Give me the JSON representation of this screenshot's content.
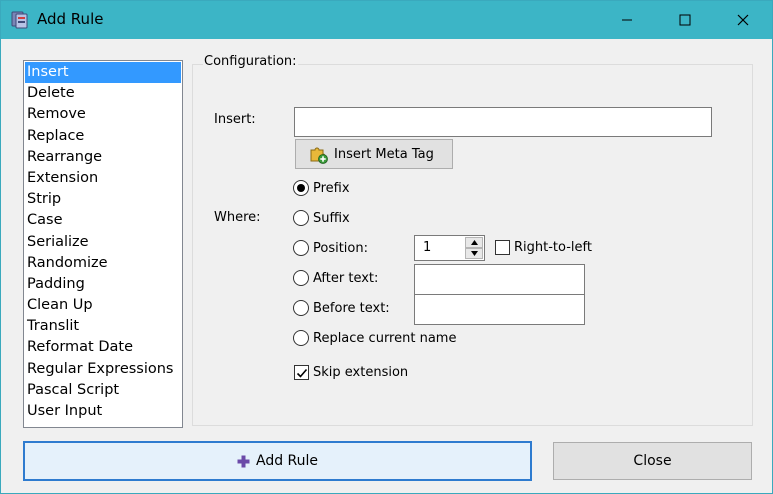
{
  "window": {
    "title": "Add Rule"
  },
  "rules": [
    "Insert",
    "Delete",
    "Remove",
    "Replace",
    "Rearrange",
    "Extension",
    "Strip",
    "Case",
    "Serialize",
    "Randomize",
    "Padding",
    "Clean Up",
    "Translit",
    "Reformat Date",
    "Regular Expressions",
    "Pascal Script",
    "User Input"
  ],
  "selected_rule": "Insert",
  "config": {
    "title": "Configuration:",
    "insert_label": "Insert:",
    "insert_value": "",
    "meta_tag_button": "Insert Meta Tag",
    "where_label": "Where:",
    "options": {
      "prefix": "Prefix",
      "suffix": "Suffix",
      "position": "Position:",
      "after_text": "After text:",
      "before_text": "Before text:",
      "replace_name": "Replace current name"
    },
    "selected_option": "prefix",
    "position_value": "1",
    "right_to_left": "Right-to-left",
    "right_to_left_checked": false,
    "skip_extension": "Skip extension",
    "skip_extension_checked": true,
    "after_text_value": "",
    "before_text_value": ""
  },
  "buttons": {
    "add_rule": "Add Rule",
    "close": "Close"
  },
  "colors": {
    "titlebar": "#3cb5c6",
    "selection": "#3399ff",
    "default_button_border": "#2e7bcf",
    "add_icon": "#6b4aa8"
  },
  "icons": {
    "app": "app-icon",
    "minimize": "minimize-icon",
    "maximize": "maximize-icon",
    "close": "close-icon",
    "meta_tag": "puzzle-add-icon",
    "add_rule": "plus-icon"
  }
}
